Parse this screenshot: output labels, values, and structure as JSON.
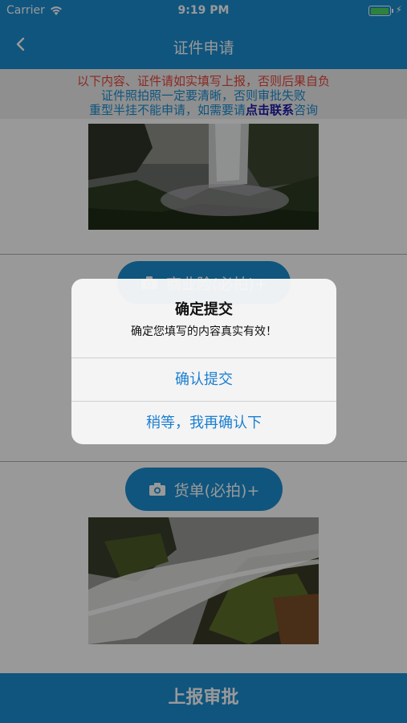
{
  "status_bar": {
    "carrier": "Carrier",
    "time": "9:19 PM"
  },
  "nav": {
    "title": "证件申请"
  },
  "notice": {
    "line1": "以下内容、证件请如实填写上报，否则后果自负",
    "line2": "证件照拍照一定要清晰，否则审批失败",
    "line3_prefix": "重型半挂不能申请，如需要请",
    "line3_link": "点击联系",
    "line3_suffix": "咨询"
  },
  "buttons": {
    "insurance": "商业险(必拍)+",
    "waybill": "货单(必拍)+"
  },
  "submit": {
    "label": "上报审批"
  },
  "alert": {
    "title": "确定提交",
    "message": "确定您填写的内容真实有效！",
    "confirm": "确认提交",
    "cancel": "稍等，我再确认下"
  },
  "colors": {
    "brand_blue": "#1a8ed3",
    "warning_red": "#e8463c",
    "link_dark_blue": "#1c1aa8",
    "alert_action": "#1a7fd0"
  },
  "icons": [
    "back-chevron-icon",
    "camera-icon",
    "wifi-icon",
    "battery-icon"
  ]
}
